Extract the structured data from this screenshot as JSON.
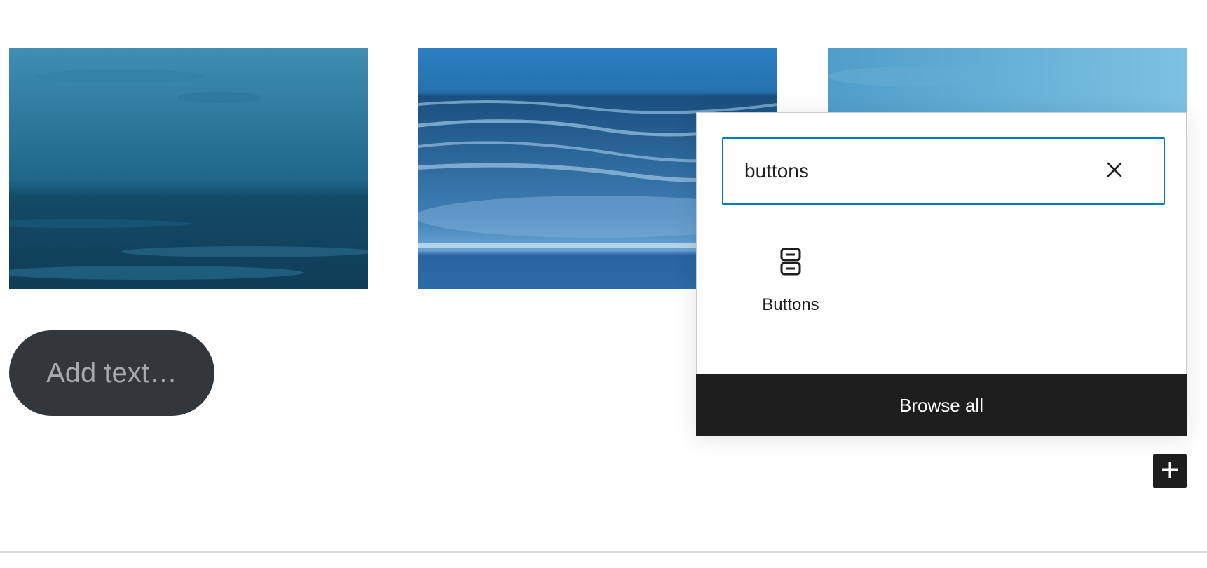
{
  "gallery": {
    "images": [
      {
        "alt": "",
        "tone": "#1b5e82"
      },
      {
        "alt": "",
        "tone": "#2a73b0"
      },
      {
        "alt": "",
        "tone": "#5aaedb"
      }
    ]
  },
  "button_block": {
    "placeholder": "Add text…"
  },
  "inserter": {
    "search_value": "buttons",
    "clear_icon": "close-icon",
    "results": [
      {
        "label": "Buttons",
        "icon": "buttons-block-icon"
      }
    ],
    "browse_all_label": "Browse all"
  },
  "toolbar": {
    "add_block_icon": "plus-icon"
  },
  "colors": {
    "accent": "#007cba",
    "dark": "#1e1e1e",
    "button_bg": "#32373c"
  }
}
